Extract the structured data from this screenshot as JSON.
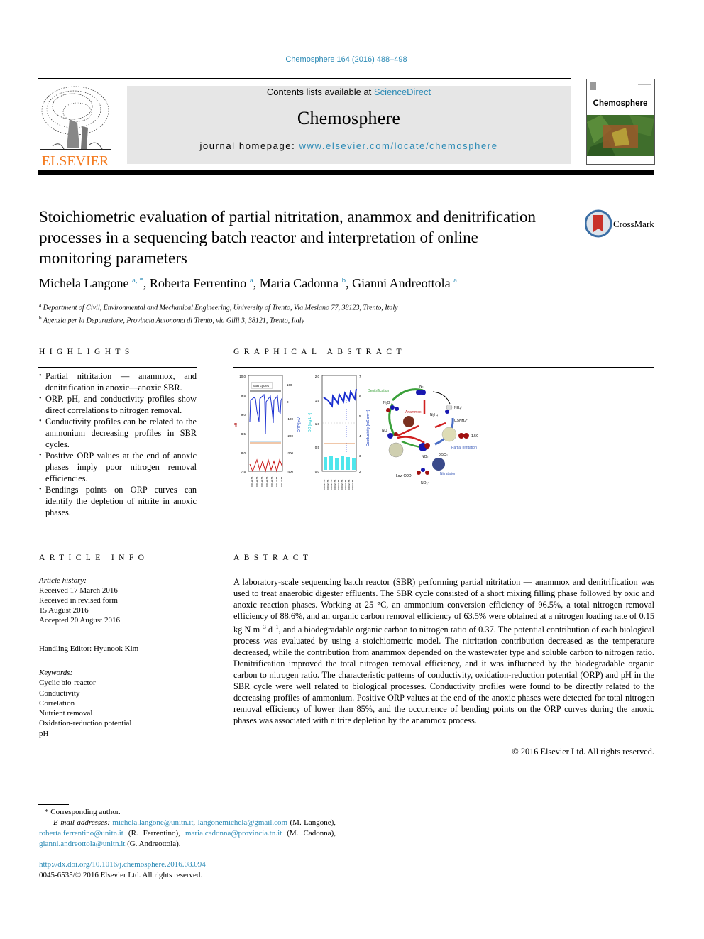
{
  "header": {
    "journal_reference": "Chemosphere 164 (2016) 488–498",
    "contents_prefix": "Contents lists available at ",
    "contents_link": "ScienceDirect",
    "journal_name": "Chemosphere",
    "homepage_prefix": "journal homepage: ",
    "homepage_link": "www.elsevier.com/locate/chemosphere",
    "publisher_logo_text": "ELSEVIER",
    "cover_title": "Chemosphere",
    "crossmark_label": "CrossMark",
    "colors": {
      "link": "#2b8ab5",
      "elsevier_orange": "#f47b20",
      "masthead_bg": "#e6e6e6"
    }
  },
  "article": {
    "title": "Stoichiometric evaluation of partial nitritation, anammox and denitrification processes in a sequencing batch reactor and interpretation of online monitoring parameters",
    "authors": [
      {
        "name": "Michela Langone",
        "sup": "a, *"
      },
      {
        "name": "Roberta Ferrentino",
        "sup": "a"
      },
      {
        "name": "Maria Cadonna",
        "sup": "b"
      },
      {
        "name": "Gianni Andreottola",
        "sup": "a"
      }
    ],
    "affiliations": [
      {
        "sup": "a",
        "text": "Department of Civil, Environmental and Mechanical Engineering, University of Trento, Via Mesiano 77, 38123, Trento, Italy"
      },
      {
        "sup": "b",
        "text": "Agenzia per la Depurazione, Provincia Autonoma di Trento, via Gilli 3, 38121, Trento, Italy"
      }
    ]
  },
  "highlights": {
    "heading": "HIGHLIGHTS",
    "items": [
      "Partial nitritation — anammox, and denitrification in anoxic—anoxic SBR.",
      "ORP, pH, and conductivity profiles show direct correlations to nitrogen removal.",
      "Conductivity profiles can be related to the ammonium decreasing profiles in SBR cycles.",
      "Positive ORP values at the end of anoxic phases imply poor nitrogen removal efficiencies.",
      "Bendings points on ORP curves can identify the depletion of nitrite in anoxic phases."
    ]
  },
  "graphical_abstract": {
    "heading": "GRAPHICAL ABSTRACT",
    "left_chart": {
      "legend": "SBR cycles",
      "y_left_label": "pH",
      "y_left_ticks": [
        "10.0",
        "9.5",
        "9.0",
        "8.5",
        "8.0",
        "7.5"
      ],
      "y_right_label": "ORP [mV]",
      "y_right_ticks": [
        "100",
        "0",
        "-100",
        "-200",
        "-300",
        "-400"
      ],
      "phase_labels": [
        "Oxic phases",
        "Anoxic phases"
      ]
    },
    "right_chart": {
      "y_left_label": "DO [mg L⁻¹]",
      "y_left_ticks": [
        "2.0",
        "1.5",
        "1.0",
        "0.5",
        "0.0"
      ],
      "y_right_label": "Conductivity [mS cm⁻¹]",
      "y_right_ticks": [
        "7",
        "6",
        "5",
        "4",
        "3",
        "2"
      ]
    },
    "diagram": {
      "labels": [
        "N₂",
        "N₂O",
        "NO",
        "NH₄⁺",
        "0.5NH₄⁺",
        "NO₂⁻",
        "NO₃⁻",
        "1.5O₂",
        "0.5O₂",
        "N₂H₄",
        "Low COD",
        "Partial nitritation",
        "Anammox",
        "Denitrification",
        "Nitratation"
      ]
    }
  },
  "article_info": {
    "heading": "ARTICLE INFO",
    "history_label": "Article history:",
    "history": [
      "Received 17 March 2016",
      "Received in revised form",
      "15 August 2016",
      "Accepted 20 August 2016"
    ],
    "handling_editor": "Handling Editor: Hyunook Kim",
    "keywords_label": "Keywords:",
    "keywords": [
      "Cyclic bio-reactor",
      "Conductivity",
      "Correlation",
      "Nutrient removal",
      "Oxidation-reduction potential",
      "pH"
    ]
  },
  "abstract": {
    "heading": "ABSTRACT",
    "part1": "A laboratory-scale sequencing batch reactor (SBR) performing partial nitritation — anammox and denitrification was used to treat anaerobic digester effluents. The SBR cycle consisted of a short mixing filling phase followed by oxic and anoxic reaction phases. Working at 25 °C, an ammonium conversion efficiency of 96.5%, a total nitrogen removal efficiency of 88.6%, and an organic carbon removal efficiency of 63.5% were obtained at a nitrogen loading rate of 0.15 kg N m",
    "exp1": "−3",
    "part2": " d",
    "exp2": "−1",
    "part3": ", and a biodegradable organic carbon to nitrogen ratio of 0.37. The potential contribution of each biological process was evaluated by using a stoichiometric model. The nitritation contribution decreased as the temperature decreased, while the contribution from anammox depended on the wastewater type and soluble carbon to nitrogen ratio. Denitrification improved the total nitrogen removal efficiency, and it was influenced by the biodegradable organic carbon to nitrogen ratio. The characteristic patterns of conductivity, oxidation-reduction potential (ORP) and pH in the SBR cycle were well related to biological processes. Conductivity profiles were found to be directly related to the decreasing profiles of ammonium. Positive ORP values at the end of the anoxic phases were detected for total nitrogen removal efficiency of lower than 85%, and the occurrence of bending points on the ORP curves during the anoxic phases was associated with nitrite depletion by the anammox process.",
    "copyright": "© 2016 Elsevier Ltd. All rights reserved."
  },
  "footnotes": {
    "corresponding": "* Corresponding author.",
    "email_label": "E-mail addresses:",
    "emails": [
      {
        "addr": "michela.langone@unitn.it",
        "after": ", "
      },
      {
        "addr": "langonemichela@gmail.com",
        "after": " (M. Langone), "
      },
      {
        "addr": "roberta.ferrentino@unitn.it",
        "after": " (R. Ferrentino), "
      },
      {
        "addr": "maria.cadonna@provincia.tn.it",
        "after": " (M. Cadonna), "
      },
      {
        "addr": "gianni.andreottola@unitn.it",
        "after": " (G. Andreottola)."
      }
    ],
    "doi": "http://dx.doi.org/10.1016/j.chemosphere.2016.08.094",
    "issn": "0045-6535/© 2016 Elsevier Ltd. All rights reserved."
  }
}
